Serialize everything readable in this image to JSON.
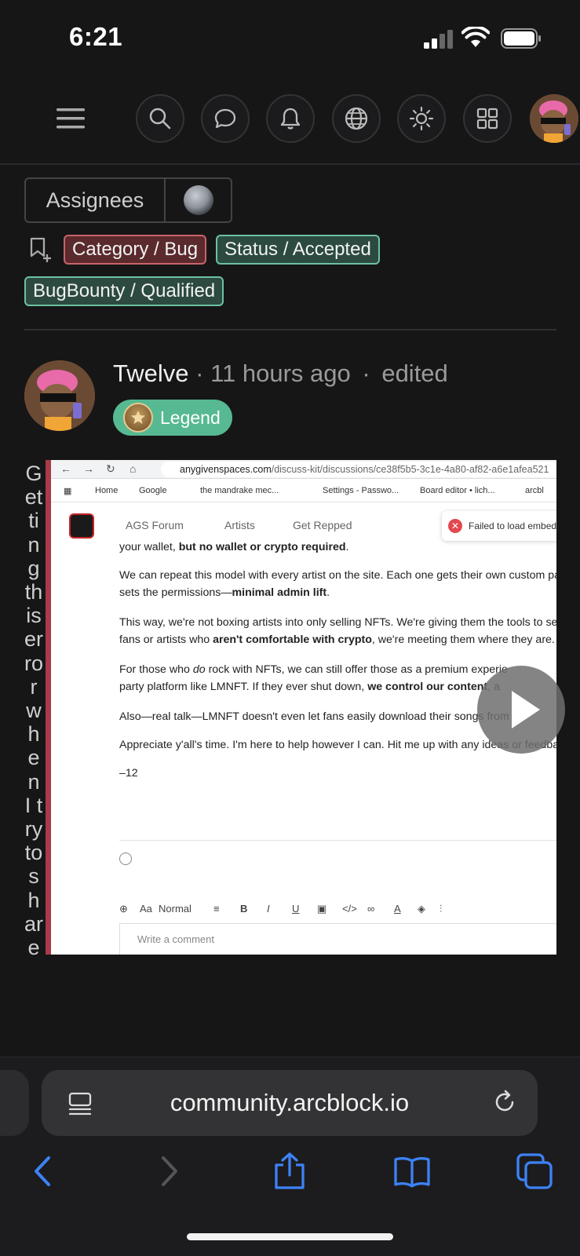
{
  "status_bar": {
    "time": "6:21"
  },
  "topnav": {
    "icons": [
      "menu-icon",
      "search-icon",
      "chat-bubble-icon",
      "bell-icon",
      "globe-icon",
      "sun-icon",
      "apps-grid-icon",
      "user-avatar"
    ]
  },
  "issue": {
    "assignees_label": "Assignees",
    "labels": [
      {
        "text": "Category / Bug",
        "color": "#c9636a"
      },
      {
        "text": "Status / Accepted",
        "color": "#6cc29f"
      },
      {
        "text": "BugBounty / Qualified",
        "color": "#6cc29f"
      }
    ]
  },
  "post": {
    "author": "Twelve",
    "time_ago": "11 hours ago",
    "edited": "edited",
    "separator": "·",
    "badge": "Legend",
    "body_text": "Getting this error when I try to share"
  },
  "embed": {
    "url_domain": "anygivenspaces.com",
    "url_path": "/discuss-kit/discussions/ce38f5b5-3c1e-4a80-af82-a6e1afea521",
    "bookmarks": [
      "Home",
      "Google",
      "the mandrake mec...",
      "Settings - Passwo...",
      "Board editor • lich...",
      "arcbl"
    ],
    "site_nav": [
      "AGS Forum",
      "Artists",
      "Get Repped"
    ],
    "toast": "Failed to load embed",
    "paragraphs": [
      {
        "line1_pre": "your wallet, ",
        "line1_bold": "but no wallet or crypto required",
        "line1_post": "."
      },
      {
        "line1": "We can repeat this model with every artist on the site. Each one gets their own custom passpo",
        "line2_pre": "sets the permissions—",
        "line2_bold": "minimal admin lift",
        "line2_post": "."
      },
      {
        "line1": "This way, we're not boxing artists into only selling NFTs. We're giving them the tools to sell mu",
        "line2_pre": "fans or artists who ",
        "line2_bold": "aren't comfortable with crypto",
        "line2_post": ", we're meeting them where they are."
      },
      {
        "line1_pre": "For those who ",
        "line1_ital": "do",
        "line1_post": " rock with NFTs, we can still offer those as a premium experie",
        "line2_pre": "party platform like LMNFT. If they ever shut down, ",
        "line2_bold": "we control our content",
        "line2_post": ", a"
      },
      {
        "line1": "Also—real talk—LMNFT doesn't even let fans easily download their songs from"
      },
      {
        "line1": "Appreciate y'all's time. I'm here to help however I can. Hit me up with any ideas or feedback!"
      },
      {
        "line1": "–12"
      }
    ],
    "editor_style": "Normal",
    "comment_placeholder": "Write a comment"
  },
  "safari": {
    "address": "community.arcblock.io",
    "toolbar": [
      "back-icon",
      "forward-icon",
      "share-icon",
      "bookmarks-icon",
      "tabs-icon"
    ]
  }
}
